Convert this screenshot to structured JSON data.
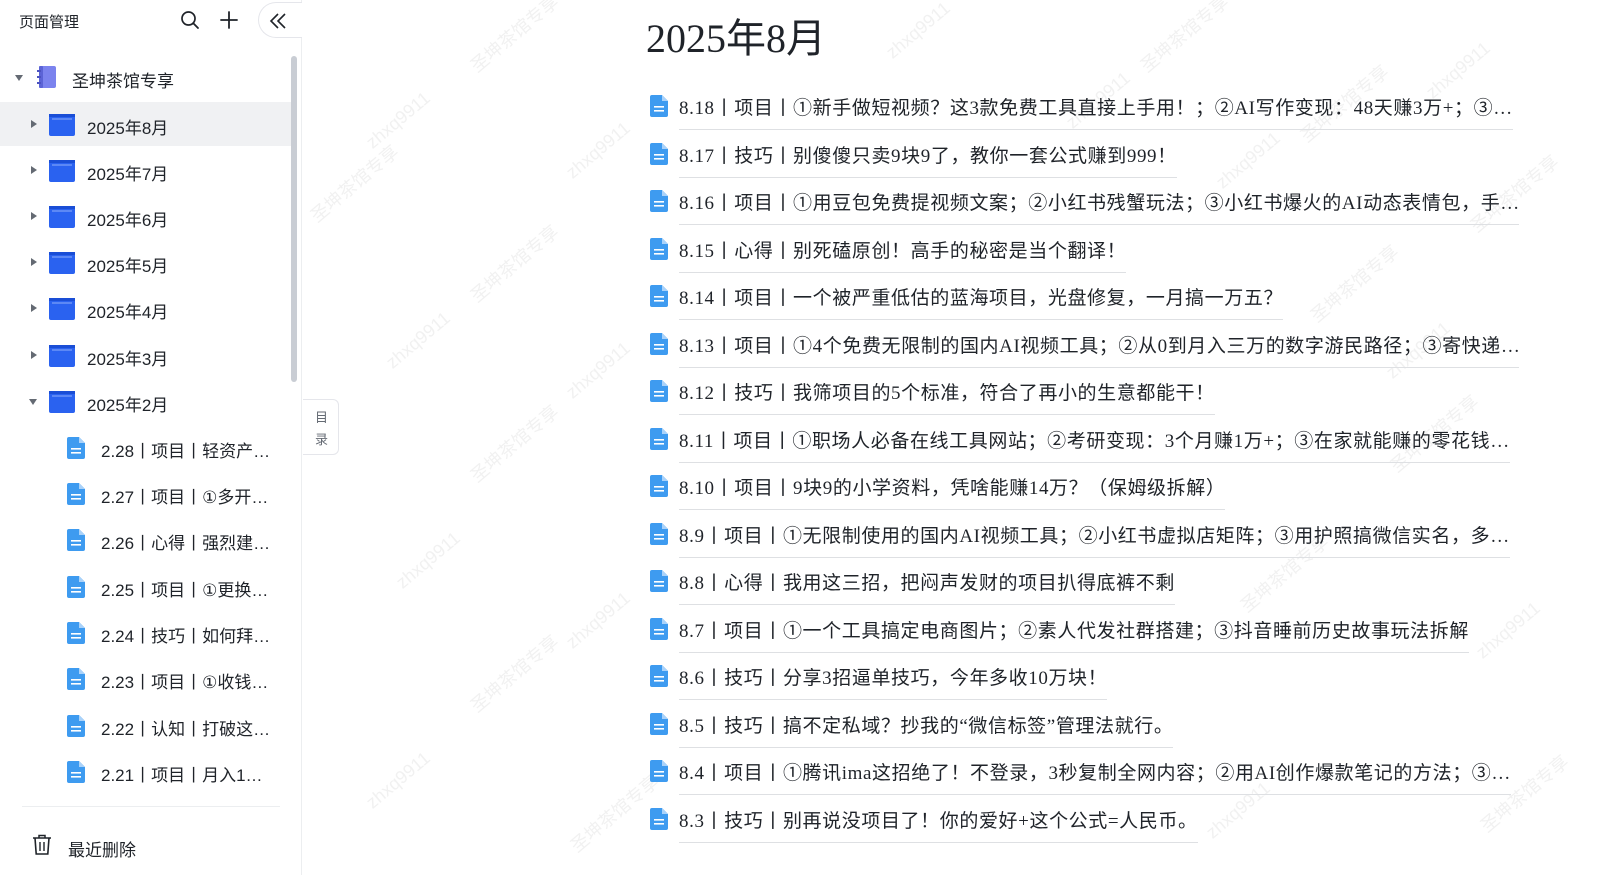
{
  "sidebar": {
    "title": "页面管理",
    "root": {
      "label": "圣坤茶馆专享"
    },
    "folders": [
      {
        "label": "2025年8月"
      },
      {
        "label": "2025年7月"
      },
      {
        "label": "2025年6月"
      },
      {
        "label": "2025年5月"
      },
      {
        "label": "2025年4月"
      },
      {
        "label": "2025年3月"
      },
      {
        "label": "2025年2月"
      }
    ],
    "subitems": [
      {
        "label": "2.28丨项目丨轻资产…"
      },
      {
        "label": "2.27丨项目丨①多开…"
      },
      {
        "label": "2.26丨心得丨强烈建…"
      },
      {
        "label": "2.25丨项目丨①更换…"
      },
      {
        "label": "2.24丨技巧丨如何拜…"
      },
      {
        "label": "2.23丨项目丨①收钱…"
      },
      {
        "label": "2.22丨认知丨打破这…"
      },
      {
        "label": "2.21丨项目丨月入1…"
      }
    ],
    "recent_deleted": "最近删除",
    "selected": "2025年8月"
  },
  "toc_tab": {
    "line1": "目",
    "line2": "录"
  },
  "main": {
    "title": "2025年8月",
    "docs": [
      {
        "text": "8.18丨项目丨①新手做短视频？这3款免费工具直接上手用！；②AI写作变现：48天赚3万+；③…"
      },
      {
        "text": "8.17丨技巧丨别傻傻只卖9块9了，教你一套公式赚到999！"
      },
      {
        "text": "8.16丨项目丨①用豆包免费提视频文案；②小红书残蟹玩法；③小红书爆火的AI动态表情包，手…"
      },
      {
        "text": "8.15丨心得丨别死磕原创！高手的秘密是当个翻译！"
      },
      {
        "text": "8.14丨项目丨一个被严重低估的蓝海项目，光盘修复，一月搞一万五？"
      },
      {
        "text": "8.13丨项目丨①4个免费无限制的国内AI视频工具；②从0到月入三万的数字游民路径；③寄快递…"
      },
      {
        "text": "8.12丨技巧丨我筛项目的5个标准，符合了再小的生意都能干！"
      },
      {
        "text": "8.11丨项目丨①职场人必备在线工具网站；②考研变现：3个月赚1万+；③在家就能赚的零花钱…"
      },
      {
        "text": "8.10丨项目丨9块9的小学资料，凭啥能赚14万？（保姆级拆解）"
      },
      {
        "text": "8.9丨项目丨①无限制使用的国内AI视频工具；②小红书虚拟店矩阵；③用护照搞微信实名，多…"
      },
      {
        "text": "8.8丨心得丨我用这三招，把闷声发财的项目扒得底裤不剩"
      },
      {
        "text": "8.7丨项目丨①一个工具搞定电商图片；②素人代发社群搭建；③抖音睡前历史故事玩法拆解"
      },
      {
        "text": "8.6丨技巧丨分享3招逼单技巧，今年多收10万块！"
      },
      {
        "text": "8.5丨技巧丨搞不定私域？抄我的“微信标签”管理法就行。"
      },
      {
        "text": "8.4丨项目丨①腾讯ima这招绝了！不登录，3秒复制全网内容；②用AI创作爆款笔记的方法；③…"
      },
      {
        "text": "8.3丨技巧丨别再说没项目了！你的爱好+这个公式=人民币。"
      }
    ]
  },
  "watermark": {
    "text1": "圣坤茶馆专享",
    "text2": "zhxq9911"
  },
  "colors": {
    "folder": "#2a62f0",
    "doc_icon": "#3e9bf0",
    "notebook": "#7b83ee",
    "selected_bg": "#f0f1f3"
  }
}
